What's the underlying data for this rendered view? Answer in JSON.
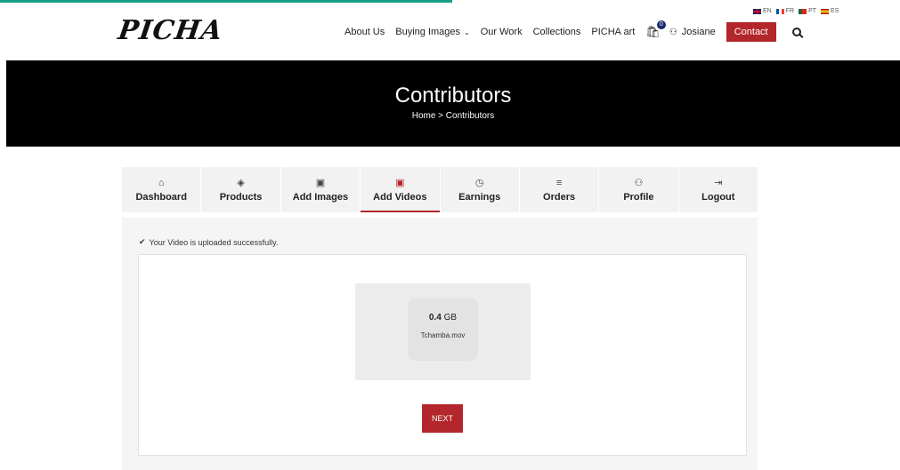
{
  "brand": {
    "logo_text": "PICHA",
    "accent_color": "#b3262b",
    "top_bar_color": "#16a085"
  },
  "languages": [
    {
      "code": "EN",
      "flag": "en"
    },
    {
      "code": "FR",
      "flag": "fr"
    },
    {
      "code": "PT",
      "flag": "pt"
    },
    {
      "code": "ES",
      "flag": "es"
    }
  ],
  "nav": {
    "about": "About Us",
    "buying": "Buying Images",
    "buying_caret": "⌄",
    "our_work": "Our Work",
    "collections": "Collections",
    "picha_art": "PICHA art",
    "cart_count": "0",
    "user_name": "Josiane",
    "contact": "Contact"
  },
  "hero": {
    "title": "Contributors",
    "breadcrumb": "Home > Contributors"
  },
  "tabs": [
    {
      "label": "Dashboard",
      "icon": "⌂",
      "icon_name": "home-icon"
    },
    {
      "label": "Products",
      "icon": "◈",
      "icon_name": "layers-icon"
    },
    {
      "label": "Add Images",
      "icon": "▣",
      "icon_name": "image-icon"
    },
    {
      "label": "Add Videos",
      "icon": "▣",
      "icon_name": "video-file-icon"
    },
    {
      "label": "Earnings",
      "icon": "◷",
      "icon_name": "tag-icon"
    },
    {
      "label": "Orders",
      "icon": "≡",
      "icon_name": "list-icon"
    },
    {
      "label": "Profile",
      "icon": "⚇",
      "icon_name": "user-icon"
    },
    {
      "label": "Logout",
      "icon": "⇥",
      "icon_name": "logout-icon"
    }
  ],
  "active_tab": "Add Videos",
  "upload": {
    "success_icon": "✔",
    "success_message": "Your Video is uploaded successfully.",
    "file_size_value": "0.4",
    "file_size_unit": "GB",
    "file_name": "Tchamba.mov",
    "next_label": "NEXT"
  }
}
